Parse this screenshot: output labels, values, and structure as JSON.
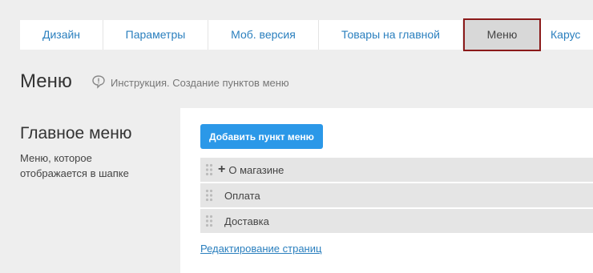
{
  "tabs": [
    {
      "label": "Дизайн"
    },
    {
      "label": "Параметры"
    },
    {
      "label": "Моб. версия"
    },
    {
      "label": "Товары на главной"
    },
    {
      "label": "Меню",
      "active": true
    },
    {
      "label": "Карус"
    }
  ],
  "page": {
    "title": "Меню",
    "instruction": "Инструкция. Создание пунктов меню"
  },
  "section": {
    "title": "Главное меню",
    "description": "Меню, которое отображается в шапке"
  },
  "panel": {
    "add_button": "Добавить пункт меню",
    "items": [
      {
        "label": "О магазине",
        "icon": "plus-icon"
      },
      {
        "label": "Оплата"
      },
      {
        "label": "Доставка"
      }
    ],
    "edit_link": "Редактирование страниц"
  },
  "colors": {
    "accent": "#2b98e8",
    "link": "#2a7fbe",
    "active_tab_border": "#8b1a1a"
  }
}
